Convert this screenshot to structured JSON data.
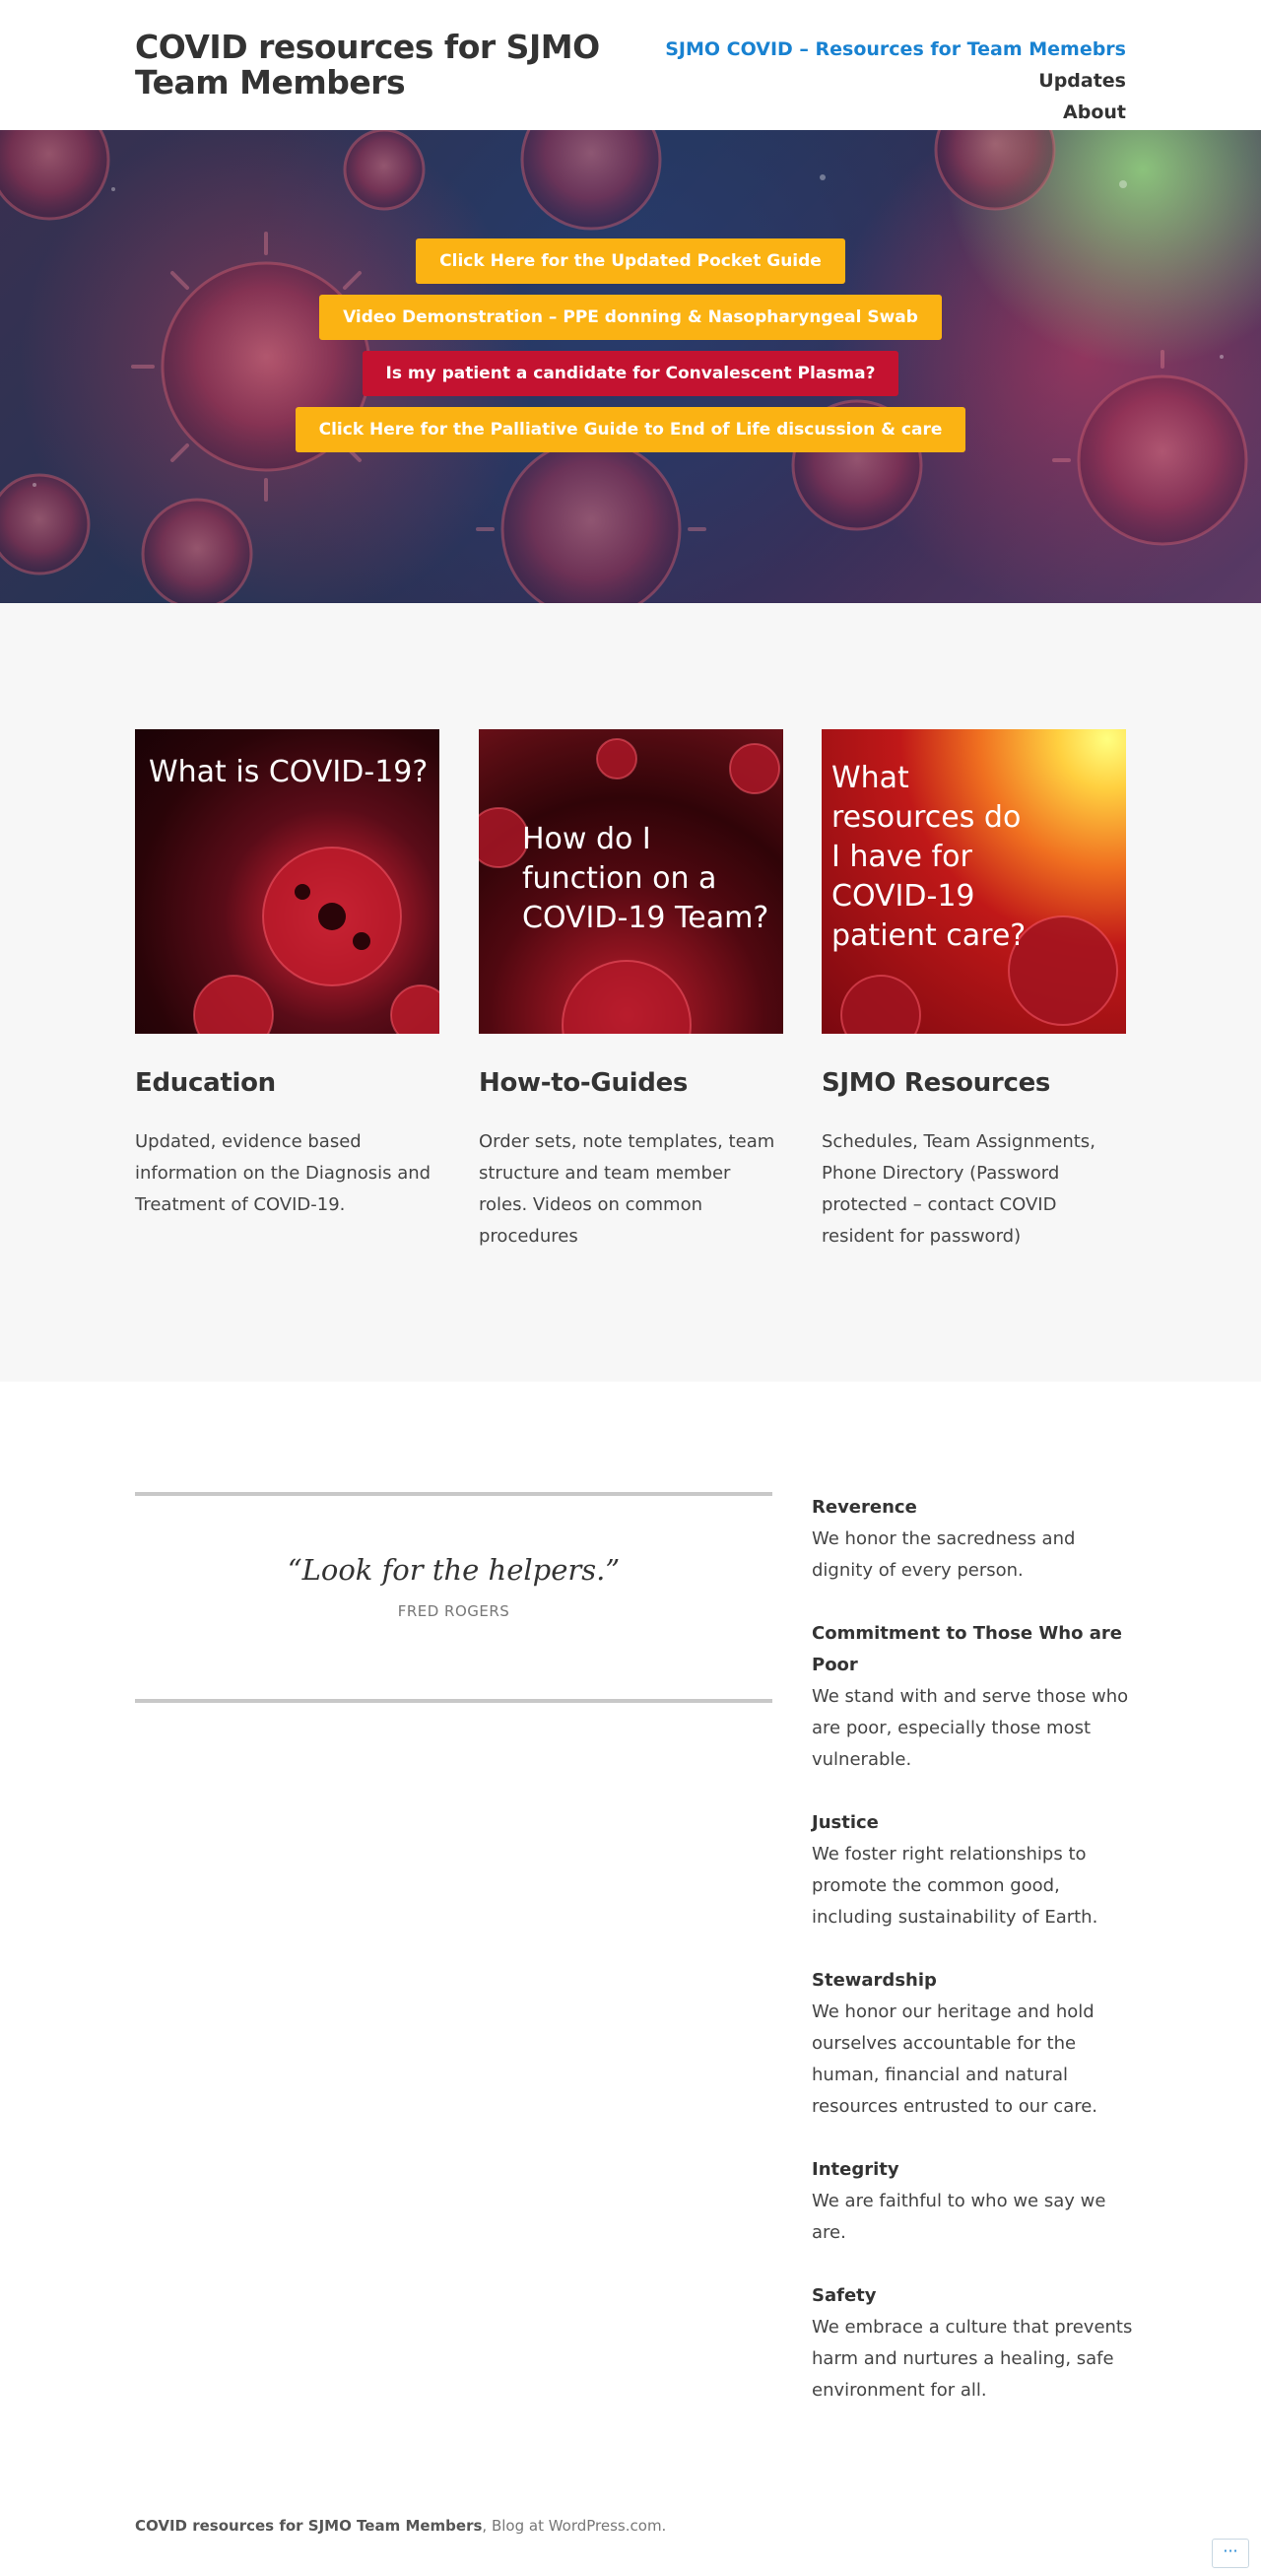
{
  "header": {
    "site_title": "COVID resources for SJMO Team Members",
    "nav": [
      {
        "label": "SJMO COVID – Resources for Team Memebrs",
        "current": true
      },
      {
        "label": "Updates",
        "current": false
      },
      {
        "label": "About",
        "current": false
      }
    ]
  },
  "hero": {
    "buttons": [
      {
        "label": "Click Here for the Updated Pocket Guide",
        "color": "#fbb313"
      },
      {
        "label": "Video Demonstration – PPE donning & Nasopharyngeal Swab",
        "color": "#fbb313"
      },
      {
        "label": "Is my patient a candidate for Convalescent Plasma?",
        "color": "#c41230"
      },
      {
        "label": "Click Here for the Palliative Guide to End of Life discussion & care",
        "color": "#fbb313"
      }
    ]
  },
  "features": [
    {
      "image_text": "What is COVID-19?",
      "title": "Education",
      "description": "Updated, evidence based information on the Diagnosis and Treatment of COVID-19."
    },
    {
      "image_text": "How do I function on a COVID-19 Team?",
      "title": "How-to-Guides",
      "description": "Order sets, note templates, team structure and team member roles. Videos on common procedures"
    },
    {
      "image_text": "What resources do I have for COVID-19 patient care?",
      "title": "SJMO Resources",
      "description": "Schedules, Team Assignments, Phone Directory (Password protected – contact COVID resident for password)"
    }
  ],
  "quote": {
    "text": "“Look for the helpers.”",
    "cite": "FRED ROGERS"
  },
  "values": [
    {
      "title": "Reverence",
      "text": "We honor the sacredness and dignity of every person."
    },
    {
      "title": "Commitment to Those Who are Poor",
      "text": "We stand with and serve those who are poor, especially those most vulnerable."
    },
    {
      "title": "Justice",
      "text": "We foster right relationships to promote the common good, including sustainability of Earth."
    },
    {
      "title": "Stewardship",
      "text": "We honor our heritage and hold ourselves accountable for the human, financial and natural resources entrusted to our care."
    },
    {
      "title": "Integrity",
      "text": "We are faithful to who we say we are."
    },
    {
      "title": "Safety",
      "text": "We embrace a culture that prevents harm and nurtures a healing, safe environment for all."
    }
  ],
  "footer": {
    "site_name": "COVID resources for SJMO Team Members",
    "separator": ", ",
    "credit": "Blog at WordPress.com."
  },
  "actionbar": {
    "icon": "more-dots-icon",
    "glyph": "···"
  },
  "colors": {
    "accent_link": "#1982d1",
    "button_yellow": "#fbb313",
    "button_red": "#c41230",
    "section_bg": "#f7f7f7"
  }
}
